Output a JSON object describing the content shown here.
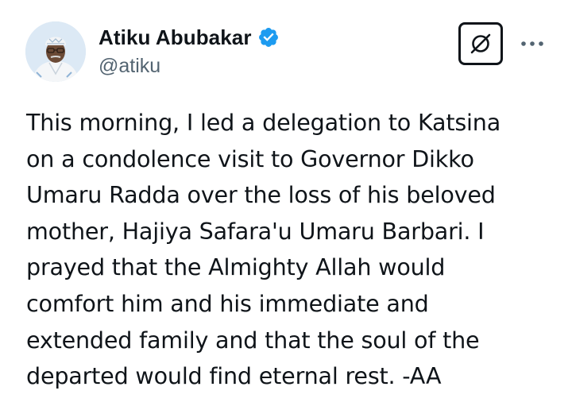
{
  "author": {
    "display_name": "Atiku Abubakar",
    "handle": "@atiku",
    "verified": true,
    "verified_color": "#1d9bf0"
  },
  "icons": {
    "avatar": "profile-photo",
    "verified": "verified-badge-icon",
    "grok": "grok-icon",
    "more": "more-options-icon"
  },
  "tweet": {
    "text": "This morning, I led a delegation to Katsina\non a condolence visit to Governor Dikko\nUmaru Radda over the loss of his beloved\nmother, Hajiya Safara'u Umaru Barbari. I\nprayed that the Almighty Allah would\ncomfort him and his immediate and\nextended family and that the soul of the\ndeparted would find eternal rest. -AA"
  },
  "colors": {
    "text_primary": "#0f1419",
    "text_secondary": "#536471",
    "accent": "#1d9bf0"
  }
}
